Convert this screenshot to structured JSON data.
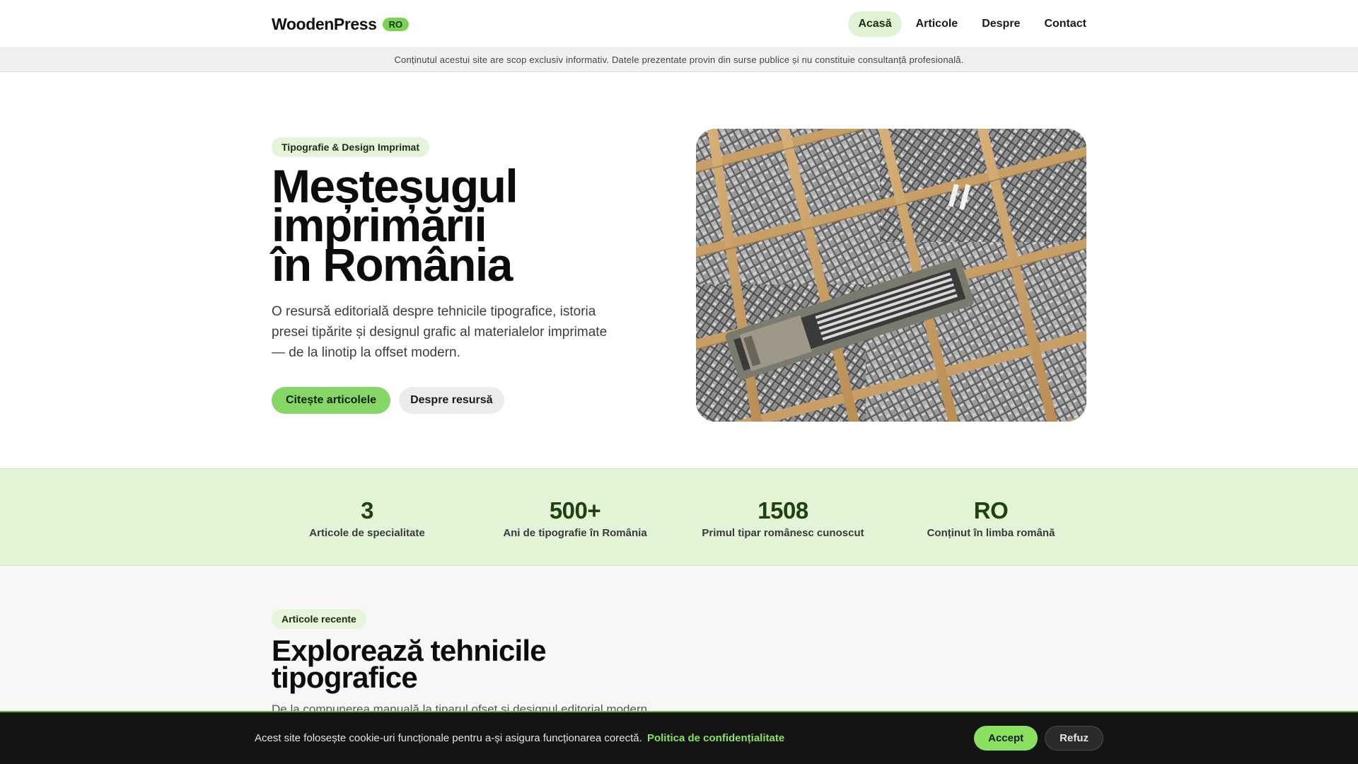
{
  "header": {
    "logo": "WoodenPress",
    "badge": "RO",
    "nav": [
      {
        "label": "Acasă",
        "active": true
      },
      {
        "label": "Articole",
        "active": false
      },
      {
        "label": "Despre",
        "active": false
      },
      {
        "label": "Contact",
        "active": false
      }
    ]
  },
  "disclaimer": "Conținutul acestui site are scop exclusiv informativ. Datele prezentate provin din surse publice și nu constituie consultanță profesională.",
  "hero": {
    "tag": "Tipografie & Design Imprimat",
    "title_lines": [
      "Meșteșugul",
      "imprimării",
      "în România"
    ],
    "description": "O resursă editorială despre tehnicile tipografice, istoria presei tipărite și designul grafic al materialelor imprimate — de la linotip la offset modern.",
    "primary_button": "Citește articolele",
    "secondary_button": "Despre resursă",
    "image_alt": "Casetă cu litere tipografice de plumb"
  },
  "stats": [
    {
      "value": "3",
      "label": "Articole de specialitate"
    },
    {
      "value": "500+",
      "label": "Ani de tipografie în România"
    },
    {
      "value": "1508",
      "label": "Primul tipar românesc cunoscut"
    },
    {
      "value": "RO",
      "label": "Conținut în limba română"
    }
  ],
  "articles": {
    "tag": "Articole recente",
    "title": "Explorează tehnicile tipografice",
    "description": "De la compunerea manuală la tiparul ofset și designul editorial modern."
  },
  "cookie": {
    "text": "Acest site folosește cookie-uri funcționale pentru a-și asigura funcționarea corectă.",
    "link": "Politica de confidențialitate",
    "accept": "Accept",
    "refuse": "Refuz"
  },
  "colors": {
    "accent": "#86d866",
    "accent_light": "#e3f4d7",
    "dark": "#141414"
  }
}
